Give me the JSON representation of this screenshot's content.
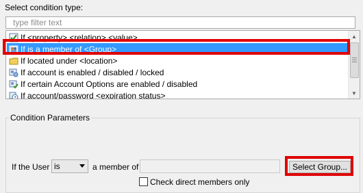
{
  "header": {
    "select_label": "Select condition type:"
  },
  "filter": {
    "placeholder": "type filter text",
    "value": ""
  },
  "conditions": [
    {
      "label": "If <property> <relation> <value>",
      "icon": "property-condition-icon",
      "selected": false
    },
    {
      "label": "If is a member of <Group>",
      "icon": "group-member-icon",
      "selected": true
    },
    {
      "label": "If located under <location>",
      "icon": "folder-location-icon",
      "selected": false
    },
    {
      "label": "If account is enabled / disabled / locked",
      "icon": "account-status-icon",
      "selected": false
    },
    {
      "label": "If certain Account Options are enabled / disabled",
      "icon": "account-options-icon",
      "selected": false
    },
    {
      "label": "If account/password <expiration status>",
      "icon": "clock-expiration-icon",
      "selected": false
    }
  ],
  "params": {
    "title": "Condition Parameters",
    "if_label": "If the User",
    "operator": "is",
    "member_label": "a member of",
    "group_value": "",
    "select_group_button": "Select Group...",
    "check_direct_label": "Check direct members only",
    "check_direct": false
  },
  "colors": {
    "selection": "#3399ff",
    "highlight": "#e00000"
  }
}
